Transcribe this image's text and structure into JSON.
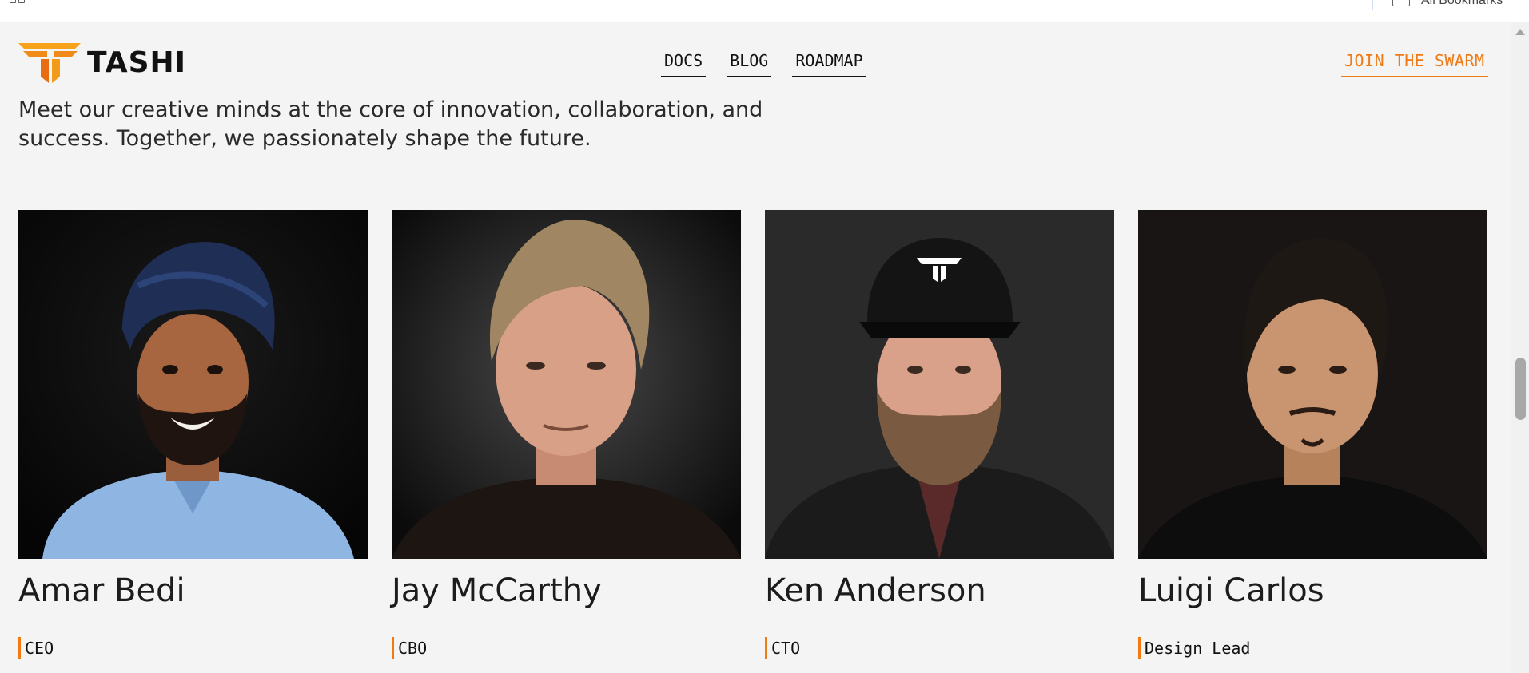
{
  "browser": {
    "bookmarks_label": "All Bookmarks"
  },
  "header": {
    "logo_text": "TASHI",
    "nav": [
      {
        "label": "DOCS"
      },
      {
        "label": "BLOG"
      },
      {
        "label": "ROADMAP"
      }
    ],
    "cta_label": "JOIN THE SWARM"
  },
  "intro": {
    "text": "Meet our creative minds at the core of innovation, collaboration, and success. Together, we passionately shape the future."
  },
  "team": [
    {
      "name": "Amar Bedi",
      "role": "CEO"
    },
    {
      "name": "Jay McCarthy",
      "role": "CBO"
    },
    {
      "name": "Ken Anderson",
      "role": "CTO"
    },
    {
      "name": "Luigi Carlos",
      "role": "Design Lead"
    }
  ],
  "colors": {
    "accent": "#f07a14",
    "background": "#f4f4f4",
    "text": "#1e1e1e"
  }
}
